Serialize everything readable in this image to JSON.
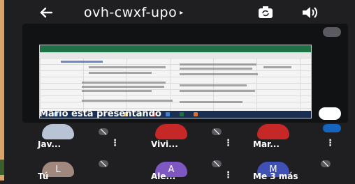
{
  "meeting": {
    "title": "ovh-cwxf-upo",
    "presenter_text": "Mario está presentando"
  },
  "participants": [
    {
      "name": "Jav...",
      "initial": "",
      "color": "#b8c4d6"
    },
    {
      "name": "Vivi...",
      "initial": "",
      "color": "#c62828"
    },
    {
      "name": "Mar...",
      "initial": "",
      "color": "#c62828"
    },
    {
      "name": "Tú",
      "initial": "L",
      "color": "#a1887f"
    },
    {
      "name": "Ale...",
      "initial": "A",
      "color": "#7e57c2"
    },
    {
      "name": "Me 3 más",
      "initial": "M",
      "color": "#3f51b5"
    }
  ],
  "colors": {
    "background": "#1f1f22",
    "spreadsheet_ribbon": "#1e7145"
  }
}
